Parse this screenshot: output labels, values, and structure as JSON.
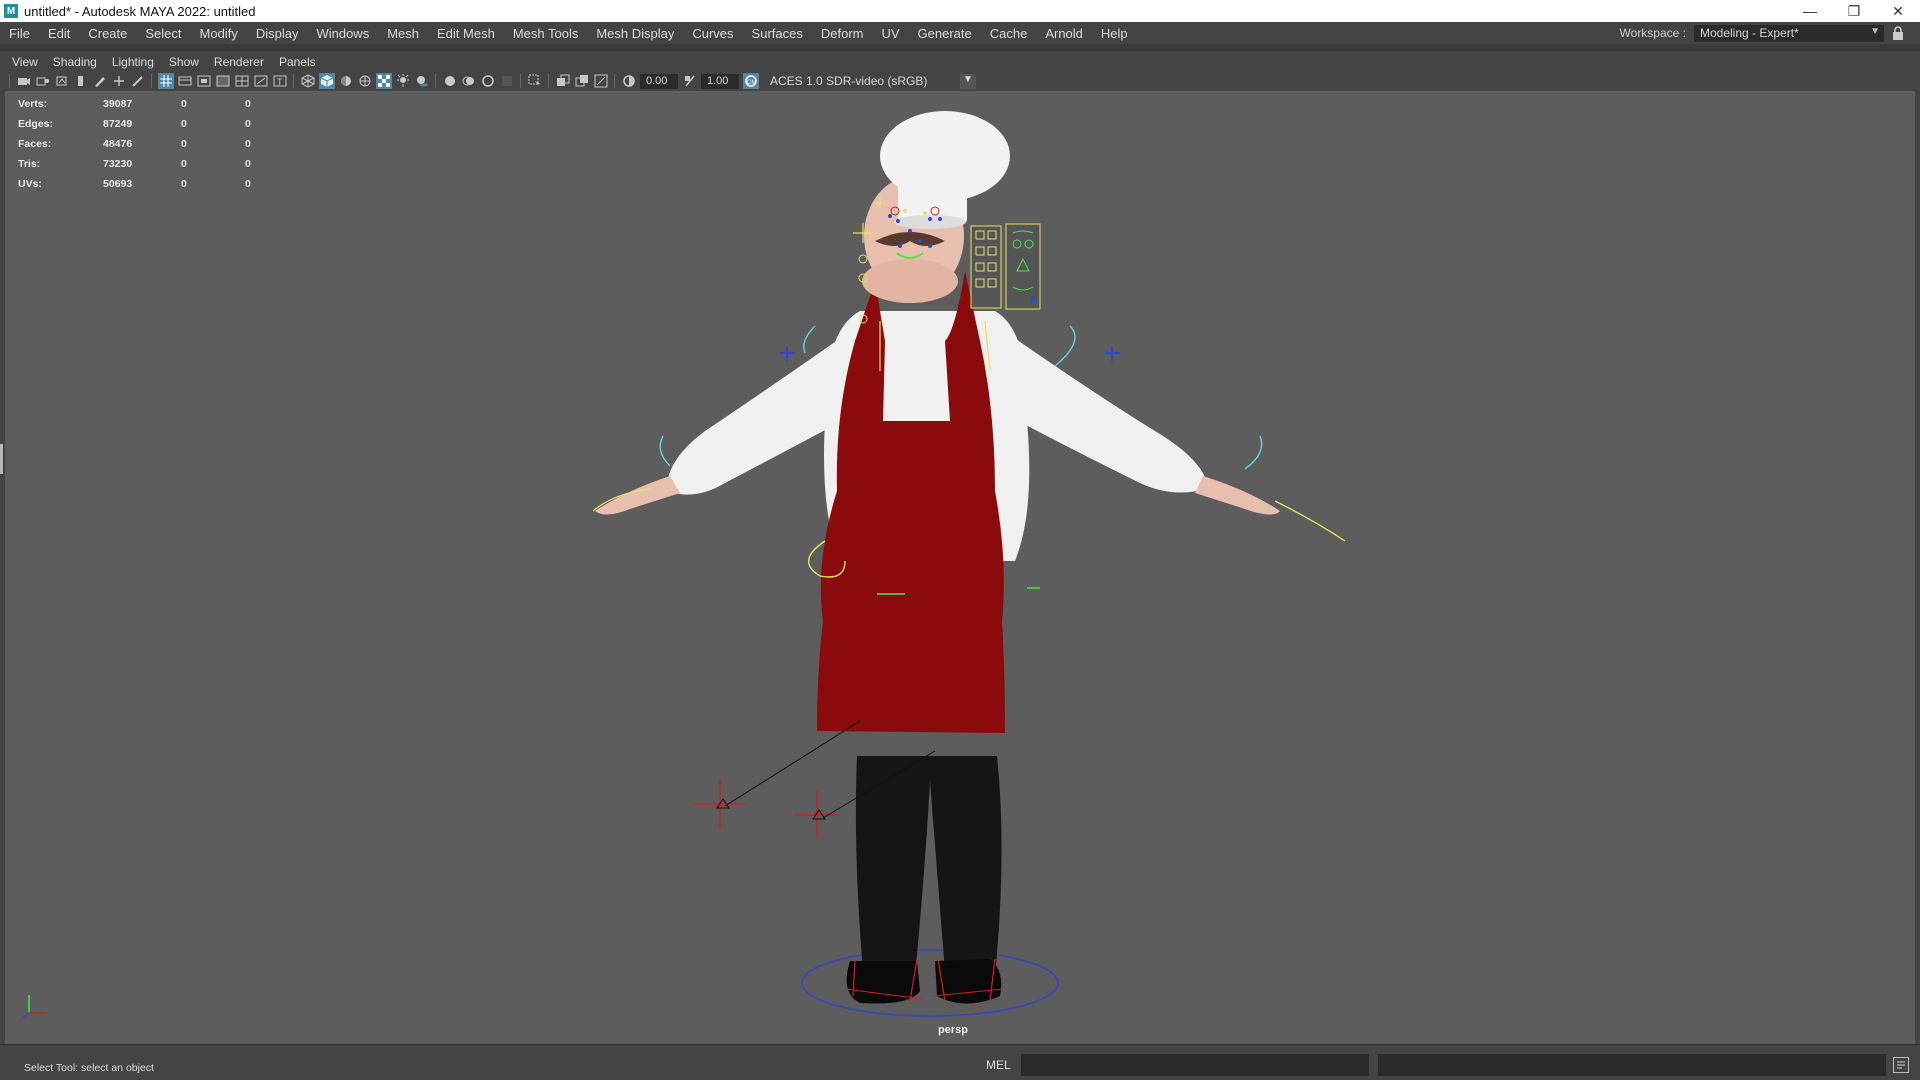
{
  "window": {
    "app_icon": "M",
    "title": "untitled* - Autodesk MAYA 2022: untitled",
    "minimize_glyph": "—",
    "restore_glyph": "❐",
    "close_glyph": "✕"
  },
  "menubar": {
    "items": [
      "File",
      "Edit",
      "Create",
      "Select",
      "Modify",
      "Display",
      "Windows",
      "Mesh",
      "Edit Mesh",
      "Mesh Tools",
      "Mesh Display",
      "Curves",
      "Surfaces",
      "Deform",
      "UV",
      "Generate",
      "Cache",
      "Arnold",
      "Help"
    ]
  },
  "workspace": {
    "label": "Workspace :",
    "value": "Modeling - Expert*",
    "chevron": "▼",
    "lock_icon": "lock-icon"
  },
  "panel_menu": {
    "items": [
      "View",
      "Shading",
      "Lighting",
      "Show",
      "Renderer",
      "Panels"
    ]
  },
  "panel_toolbar": {
    "exposure_value": "0.00",
    "gamma_value": "1.00",
    "color_space": "ACES 1.0 SDR-video (sRGB)",
    "chevron": "▼"
  },
  "hud": {
    "rows": [
      {
        "label": "Verts:",
        "value": "39087",
        "sel": "0",
        "comp": "0"
      },
      {
        "label": "Edges:",
        "value": "87249",
        "sel": "0",
        "comp": "0"
      },
      {
        "label": "Faces:",
        "value": "48476",
        "sel": "0",
        "comp": "0"
      },
      {
        "label": "Tris:",
        "value": "73230",
        "sel": "0",
        "comp": "0"
      },
      {
        "label": "UVs:",
        "value": "50693",
        "sel": "0",
        "comp": "0"
      }
    ]
  },
  "viewport": {
    "camera": "persp",
    "colors": {
      "background": "#5d5d5d",
      "apron": "#8b0b0c",
      "shirt": "#f0f0f0",
      "skin": "#e8bfae",
      "pants": "#151515",
      "control_yellow": "#e6e35b",
      "control_cyan": "#62d4e6",
      "control_blue": "#3447c8",
      "locator_red": "#d41e1e",
      "face_green": "#4fe34f"
    }
  },
  "statusbar": {
    "message": "Select Tool: select an object",
    "mel_label": "MEL",
    "script_editor_icon": "script-editor-icon"
  }
}
